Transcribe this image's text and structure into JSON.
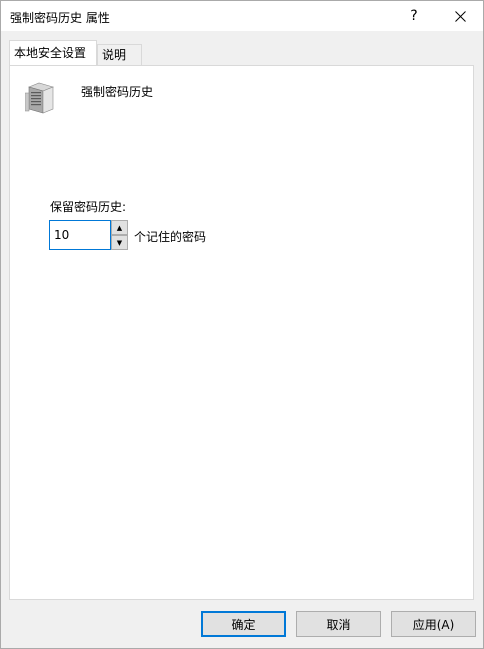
{
  "window": {
    "title": "强制密码历史 属性",
    "help_glyph": "?",
    "close_icon": "close-icon"
  },
  "tabs": [
    {
      "label": "本地安全设置",
      "active": true
    },
    {
      "label": "说明",
      "active": false
    }
  ],
  "policy": {
    "icon": "server-icon",
    "name": "强制密码历史"
  },
  "setting": {
    "label": "保留密码历史:",
    "value": "10",
    "unit": "个记住的密码"
  },
  "buttons": {
    "ok": "确定",
    "cancel": "取消",
    "apply": "应用(A)"
  },
  "colors": {
    "accent": "#0078d7",
    "panel": "#ffffff",
    "chrome": "#f0f0f0"
  }
}
